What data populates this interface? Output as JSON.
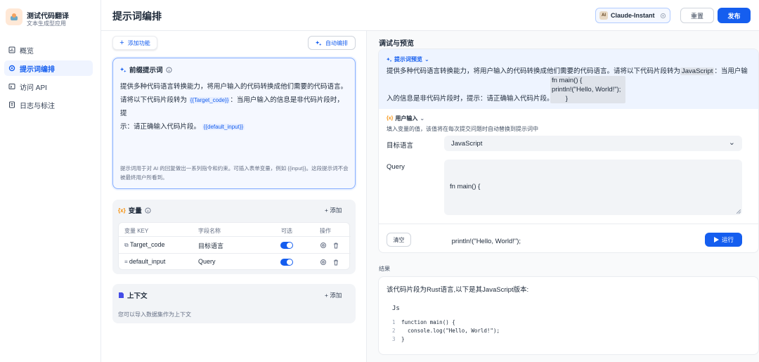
{
  "app": {
    "name": "测试代码翻译",
    "subtitle": "文本生成型应用"
  },
  "sidebar": {
    "items": [
      {
        "label": "概览",
        "icon": "overview-icon",
        "active": false
      },
      {
        "label": "提示词编排",
        "icon": "settings-icon",
        "active": true
      },
      {
        "label": "访问 API",
        "icon": "api-icon",
        "active": false
      },
      {
        "label": "日志与标注",
        "icon": "log-icon",
        "active": false
      }
    ]
  },
  "header": {
    "title": "提示词编排",
    "model": "Claude-Instant",
    "model_logo": "AI",
    "reset_label": "重置",
    "publish_label": "发布"
  },
  "left": {
    "add_func_label": "添加功能",
    "auto_label": "自动编排",
    "prompt": {
      "title": "前缀提示词",
      "line1": "提供多种代码语言转换能力，将用户输入的代码转换成他们需要的代码语言。",
      "line2_a": "请将以下代码片段转为",
      "var1": "{{Target_code}}",
      "line2_b": "：当用户输入的信息是非代码片段时，提",
      "line3_a": "示：请正确输入代码片段。",
      "var2": "{{default_input}}",
      "hint": "提示词用于对 AI 的回复做出一系列指令和约束。可插入表单变量，例如 {{input}}。这段提示词不会被最终用户所看到。"
    },
    "variables": {
      "title": "变量",
      "add_label": "添加",
      "headers": [
        "变量 KEY",
        "字段名称",
        "可选",
        "操作"
      ],
      "rows": [
        {
          "key": "Target_code",
          "name": "目标语言",
          "optional": true
        },
        {
          "key": "default_input",
          "name": "Query",
          "optional": true
        }
      ]
    },
    "context": {
      "title": "上下文",
      "add_label": "添加",
      "desc": "您可以导入数据集作为上下文"
    }
  },
  "right": {
    "title": "调试与预览",
    "preview": {
      "label": "提示词预览",
      "text_a": "提供多种代码语言转换能力，将用户输入的代码转换成他们需要的代码语言。请将以下代码片段转为",
      "hl1": "JavaScript",
      "text_b": "：当用户输",
      "code1": "fn main() {",
      "code2": "println!(\"Hello, World!\");",
      "line3_a": "入的信息是非代码片段时，提示：请正确输入代码片段。",
      "code3": "}"
    },
    "user_input": {
      "label": "用户输入",
      "desc": "填入变量的值，该值将在每次提交问题时自动替换到提示词中",
      "target_label": "目标语言",
      "target_value": "JavaScript",
      "query_label": "Query",
      "query_lines": [
        "fn main() {",
        "",
        " println!(\"Hello, World!\");",
        "",
        "}"
      ]
    },
    "clear_label": "清空",
    "run_label": "运行",
    "result": {
      "label": "结果",
      "text": "该代码片段为Rust语言,以下是其JavaScript版本:",
      "lang": "Js",
      "code": [
        {
          "n": "1",
          "t": "function main() {"
        },
        {
          "n": "2",
          "t": "  console.log(\"Hello, World!\");"
        },
        {
          "n": "3",
          "t": "}"
        }
      ]
    }
  },
  "colors": {
    "accent": "#155eef",
    "accent_bg": "#eef4ff"
  }
}
